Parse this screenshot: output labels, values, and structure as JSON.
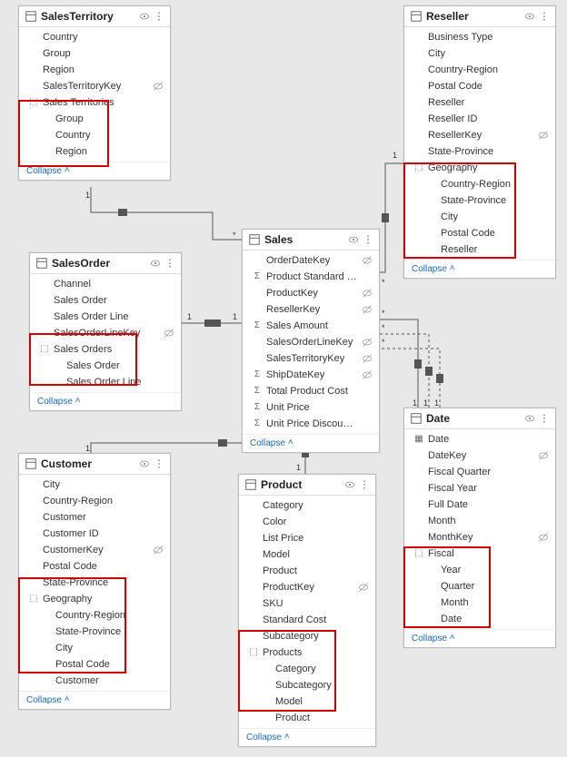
{
  "collapse_label": "Collapse",
  "tables": {
    "salesTerritory": {
      "title": "SalesTerritory",
      "fields": [
        {
          "label": "Country",
          "hidden": false
        },
        {
          "label": "Group",
          "hidden": false
        },
        {
          "label": "Region",
          "hidden": false
        },
        {
          "label": "SalesTerritoryKey",
          "hidden": true
        },
        {
          "label": "Sales Territories",
          "icon": "hierarchy",
          "hidden": false
        },
        {
          "label": "Group",
          "indent": 1
        },
        {
          "label": "Country",
          "indent": 1
        },
        {
          "label": "Region",
          "indent": 1
        }
      ]
    },
    "reseller": {
      "title": "Reseller",
      "fields": [
        {
          "label": "Business Type"
        },
        {
          "label": "City"
        },
        {
          "label": "Country-Region"
        },
        {
          "label": "Postal Code"
        },
        {
          "label": "Reseller"
        },
        {
          "label": "Reseller ID"
        },
        {
          "label": "ResellerKey",
          "hidden": true
        },
        {
          "label": "State-Province"
        },
        {
          "label": "Geography",
          "icon": "hierarchy"
        },
        {
          "label": "Country-Region",
          "indent": 1
        },
        {
          "label": "State-Province",
          "indent": 1
        },
        {
          "label": "City",
          "indent": 1
        },
        {
          "label": "Postal Code",
          "indent": 1
        },
        {
          "label": "Reseller",
          "indent": 1
        }
      ]
    },
    "salesOrder": {
      "title": "SalesOrder",
      "fields": [
        {
          "label": "Channel"
        },
        {
          "label": "Sales Order"
        },
        {
          "label": "Sales Order Line"
        },
        {
          "label": "SalesOrderLineKey",
          "hidden": true
        },
        {
          "label": "Sales Orders",
          "icon": "hierarchy"
        },
        {
          "label": "Sales Order",
          "indent": 1
        },
        {
          "label": "Sales Order Line",
          "indent": 1
        }
      ]
    },
    "sales": {
      "title": "Sales",
      "fields": [
        {
          "label": "OrderDateKey",
          "hidden": true
        },
        {
          "label": "Product Standard Cost",
          "icon": "sigma"
        },
        {
          "label": "ProductKey",
          "hidden": true
        },
        {
          "label": "ResellerKey",
          "hidden": true
        },
        {
          "label": "Sales Amount",
          "icon": "sigma"
        },
        {
          "label": "SalesOrderLineKey",
          "hidden": true
        },
        {
          "label": "SalesTerritoryKey",
          "hidden": true
        },
        {
          "label": "ShipDateKey",
          "icon": "sigma",
          "hidden": true
        },
        {
          "label": "Total Product Cost",
          "icon": "sigma"
        },
        {
          "label": "Unit Price",
          "icon": "sigma"
        },
        {
          "label": "Unit Price Discount Pct",
          "icon": "sigma"
        }
      ]
    },
    "customer": {
      "title": "Customer",
      "fields": [
        {
          "label": "City"
        },
        {
          "label": "Country-Region"
        },
        {
          "label": "Customer"
        },
        {
          "label": "Customer ID"
        },
        {
          "label": "CustomerKey",
          "hidden": true
        },
        {
          "label": "Postal Code"
        },
        {
          "label": "State-Province"
        },
        {
          "label": "Geography",
          "icon": "hierarchy"
        },
        {
          "label": "Country-Region",
          "indent": 1
        },
        {
          "label": "State-Province",
          "indent": 1
        },
        {
          "label": "City",
          "indent": 1
        },
        {
          "label": "Postal Code",
          "indent": 1
        },
        {
          "label": "Customer",
          "indent": 1
        }
      ]
    },
    "product": {
      "title": "Product",
      "fields": [
        {
          "label": "Category"
        },
        {
          "label": "Color"
        },
        {
          "label": "List Price"
        },
        {
          "label": "Model"
        },
        {
          "label": "Product"
        },
        {
          "label": "ProductKey",
          "hidden": true
        },
        {
          "label": "SKU"
        },
        {
          "label": "Standard Cost"
        },
        {
          "label": "Subcategory"
        },
        {
          "label": "Products",
          "icon": "hierarchy"
        },
        {
          "label": "Category",
          "indent": 1
        },
        {
          "label": "Subcategory",
          "indent": 1
        },
        {
          "label": "Model",
          "indent": 1
        },
        {
          "label": "Product",
          "indent": 1
        }
      ]
    },
    "date": {
      "title": "Date",
      "fields": [
        {
          "label": "Date",
          "icon": "calendar"
        },
        {
          "label": "DateKey",
          "hidden": true
        },
        {
          "label": "Fiscal Quarter"
        },
        {
          "label": "Fiscal Year"
        },
        {
          "label": "Full Date"
        },
        {
          "label": "Month"
        },
        {
          "label": "MonthKey",
          "hidden": true
        },
        {
          "label": "Fiscal",
          "icon": "hierarchy"
        },
        {
          "label": "Year",
          "indent": 1
        },
        {
          "label": "Quarter",
          "indent": 1
        },
        {
          "label": "Month",
          "indent": 1
        },
        {
          "label": "Date",
          "indent": 1
        }
      ]
    }
  },
  "cardinality": {
    "one": "1",
    "many": "*"
  },
  "relationships": [
    {
      "from": "SalesTerritory",
      "to": "Sales",
      "fromCard": "1",
      "toCard": "*"
    },
    {
      "from": "Reseller",
      "to": "Sales",
      "fromCard": "1",
      "toCard": "*"
    },
    {
      "from": "SalesOrder",
      "to": "Sales",
      "fromCard": "1",
      "toCard": "1"
    },
    {
      "from": "Customer",
      "to": "Sales",
      "fromCard": "1",
      "toCard": "*"
    },
    {
      "from": "Product",
      "to": "Sales",
      "fromCard": "1",
      "toCard": "*"
    },
    {
      "from": "Date",
      "to": "Sales",
      "fromCard": "1",
      "toCard": "*",
      "count": 3
    }
  ]
}
